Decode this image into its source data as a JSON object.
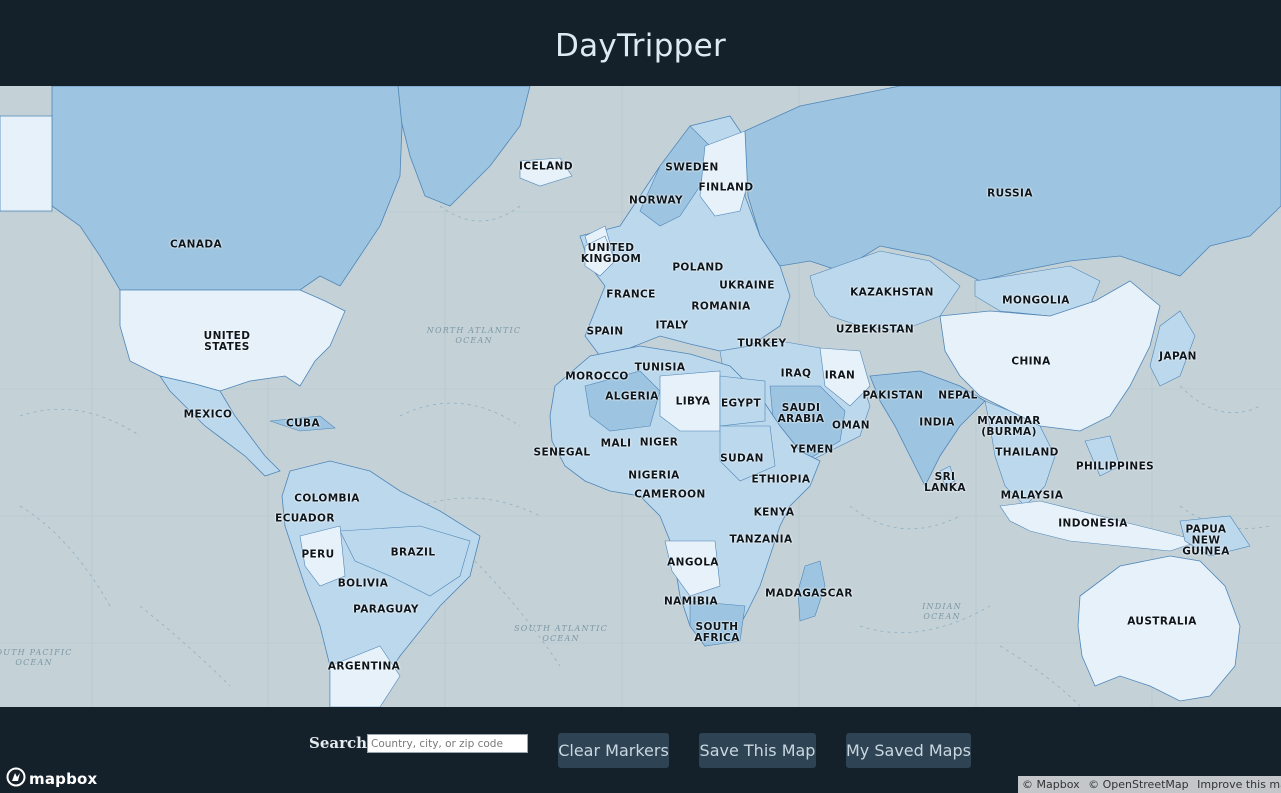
{
  "app": {
    "title": "DayTripper"
  },
  "map": {
    "country_labels": [
      {
        "id": "iceland",
        "text": "ICELAND"
      },
      {
        "id": "sweden",
        "text": "SWEDEN"
      },
      {
        "id": "finland",
        "text": "FINLAND"
      },
      {
        "id": "norway",
        "text": "NORWAY"
      },
      {
        "id": "russia",
        "text": "RUSSIA"
      },
      {
        "id": "canada",
        "text": "CANADA"
      },
      {
        "id": "united-kingdom",
        "text": "UNITED\nKINGDOM"
      },
      {
        "id": "poland",
        "text": "POLAND"
      },
      {
        "id": "ukraine",
        "text": "UKRAINE"
      },
      {
        "id": "france",
        "text": "FRANCE"
      },
      {
        "id": "romania",
        "text": "ROMANIA"
      },
      {
        "id": "kazakhstan",
        "text": "KAZAKHSTAN"
      },
      {
        "id": "mongolia",
        "text": "MONGOLIA"
      },
      {
        "id": "united-states",
        "text": "UNITED\nSTATES"
      },
      {
        "id": "spain",
        "text": "SPAIN"
      },
      {
        "id": "italy",
        "text": "ITALY"
      },
      {
        "id": "uzbekistan",
        "text": "UZBEKISTAN"
      },
      {
        "id": "turkey",
        "text": "TURKEY"
      },
      {
        "id": "china",
        "text": "CHINA"
      },
      {
        "id": "japan",
        "text": "JAPAN"
      },
      {
        "id": "tunisia",
        "text": "TUNISIA"
      },
      {
        "id": "morocco",
        "text": "MOROCCO"
      },
      {
        "id": "iraq",
        "text": "IRAQ"
      },
      {
        "id": "iran",
        "text": "IRAN"
      },
      {
        "id": "algeria",
        "text": "ALGERIA"
      },
      {
        "id": "libya",
        "text": "LIBYA"
      },
      {
        "id": "egypt",
        "text": "EGYPT"
      },
      {
        "id": "pakistan",
        "text": "PAKISTAN"
      },
      {
        "id": "nepal",
        "text": "NEPAL"
      },
      {
        "id": "mexico",
        "text": "MEXICO"
      },
      {
        "id": "saudi-arabia",
        "text": "SAUDI\nARABIA"
      },
      {
        "id": "cuba",
        "text": "CUBA"
      },
      {
        "id": "oman",
        "text": "OMAN"
      },
      {
        "id": "india",
        "text": "INDIA"
      },
      {
        "id": "myanmar",
        "text": "MYANMAR\n(BURMA)"
      },
      {
        "id": "mali",
        "text": "MALI"
      },
      {
        "id": "niger",
        "text": "NIGER"
      },
      {
        "id": "yemen",
        "text": "YEMEN"
      },
      {
        "id": "senegal",
        "text": "SENEGAL"
      },
      {
        "id": "sudan",
        "text": "SUDAN"
      },
      {
        "id": "thailand",
        "text": "THAILAND"
      },
      {
        "id": "philippines",
        "text": "PHILIPPINES"
      },
      {
        "id": "nigeria",
        "text": "NIGERIA"
      },
      {
        "id": "ethiopia",
        "text": "ETHIOPIA"
      },
      {
        "id": "sri-lanka",
        "text": "SRI\nLANKA"
      },
      {
        "id": "cameroon",
        "text": "CAMEROON"
      },
      {
        "id": "malaysia",
        "text": "MALAYSIA"
      },
      {
        "id": "colombia",
        "text": "COLOMBIA"
      },
      {
        "id": "kenya",
        "text": "KENYA"
      },
      {
        "id": "ecuador",
        "text": "ECUADOR"
      },
      {
        "id": "indonesia",
        "text": "INDONESIA"
      },
      {
        "id": "papua-new-guinea",
        "text": "PAPUA\nNEW\nGUINEA"
      },
      {
        "id": "tanzania",
        "text": "TANZANIA"
      },
      {
        "id": "brazil",
        "text": "BRAZIL"
      },
      {
        "id": "peru",
        "text": "PERU"
      },
      {
        "id": "angola",
        "text": "ANGOLA"
      },
      {
        "id": "bolivia",
        "text": "BOLIVIA"
      },
      {
        "id": "madagascar",
        "text": "MADAGASCAR"
      },
      {
        "id": "namibia",
        "text": "NAMIBIA"
      },
      {
        "id": "paraguay",
        "text": "PARAGUAY"
      },
      {
        "id": "australia",
        "text": "AUSTRALIA"
      },
      {
        "id": "south-africa",
        "text": "SOUTH\nAFRICA"
      },
      {
        "id": "argentina",
        "text": "ARGENTINA"
      }
    ],
    "ocean_labels": [
      {
        "id": "north-atlantic",
        "text": "NORTH ATLANTIC\nOCEAN"
      },
      {
        "id": "south-atlantic",
        "text": "SOUTH ATLANTIC\nOCEAN"
      },
      {
        "id": "indian",
        "text": "INDIAN\nOCEAN"
      },
      {
        "id": "south-pacific",
        "text": "OUTH PACIFIC\nOCEAN"
      }
    ],
    "colors": {
      "ocean": "#c4d2d8",
      "land_dark": "#9dc4e0",
      "land_mid": "#bcd8ec",
      "land_light": "#e6f1f9",
      "border": "#4f86b8"
    }
  },
  "search": {
    "label": "Search",
    "placeholder": "Country, city, or zip code",
    "value": ""
  },
  "buttons": {
    "clear": "Clear Markers",
    "save": "Save This Map",
    "saved": "My Saved Maps"
  },
  "brand": {
    "logo_text": "mapbox",
    "icon": "mapbox-logo-icon"
  },
  "attribution": {
    "mapbox": "© Mapbox",
    "osm": "© OpenStreetMap",
    "improve": "Improve this map"
  }
}
